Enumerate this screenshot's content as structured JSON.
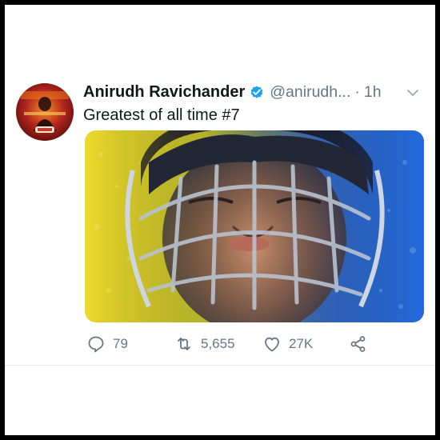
{
  "tweet": {
    "author_name": "Anirudh Ravichander",
    "handle": "@anirudh...",
    "separator": "·",
    "time": "1h",
    "text": "Greatest of all time #7",
    "verified": true
  },
  "actions": {
    "reply_count": "79",
    "retweet_count": "5,655",
    "like_count": "27K"
  },
  "colors": {
    "text_primary": "#14171a",
    "text_secondary": "#657786",
    "verified_blue": "#1da1f2",
    "image_left": "#f2e22a",
    "image_right": "#1e73e8"
  }
}
